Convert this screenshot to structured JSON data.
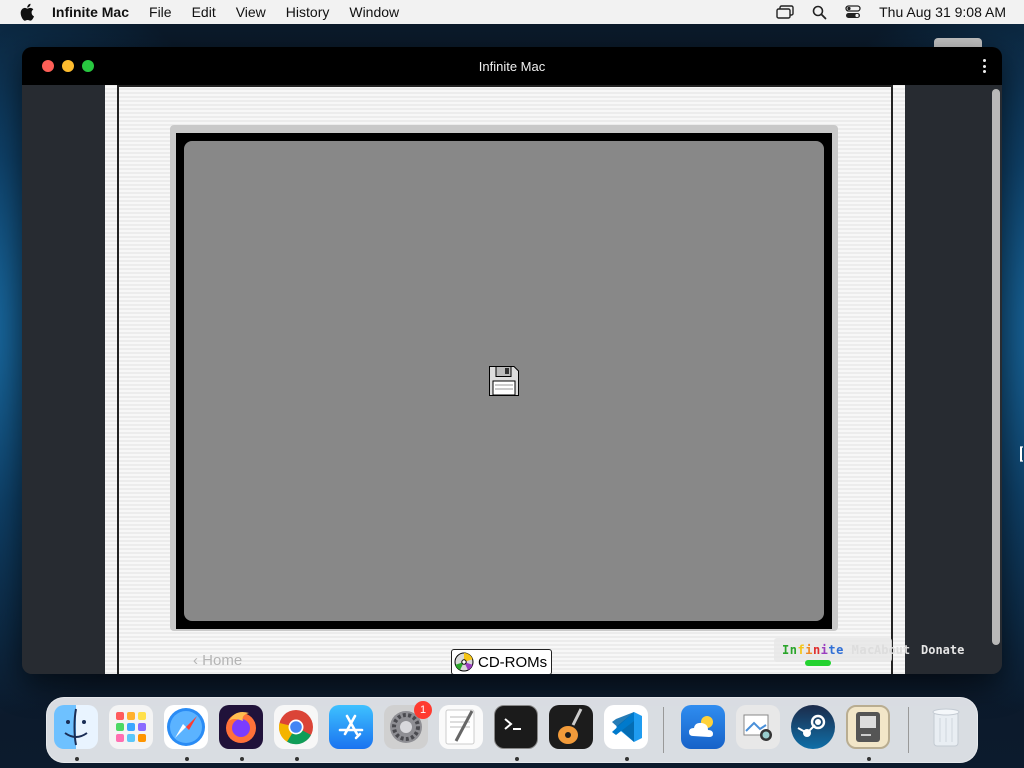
{
  "menubar": {
    "app_name": "Infinite Mac",
    "items": [
      "File",
      "Edit",
      "View",
      "History",
      "Window"
    ],
    "clock": "Thu Aug 31  9:08 AM",
    "status_icons": [
      "screen-mirroring-icon",
      "spotlight-search-icon",
      "control-center-icon"
    ]
  },
  "window": {
    "title": "Infinite Mac",
    "traffic_lights": {
      "close": "#fe5f57",
      "minimize": "#febc2e",
      "zoom": "#28c840"
    }
  },
  "emulator": {
    "screen_color": "#888888",
    "disk_icon": "floppy-disk-icon",
    "home_link": "‹ Home",
    "cdrom_button": "CD-ROMs",
    "footer": {
      "logo_letters": [
        {
          "ch": "I",
          "color": "#2aa52a"
        },
        {
          "ch": "n",
          "color": "#2aa52a"
        },
        {
          "ch": "f",
          "color": "#f5c518"
        },
        {
          "ch": "i",
          "color": "#f08a24"
        },
        {
          "ch": "n",
          "color": "#e03030"
        },
        {
          "ch": "i",
          "color": "#9b3fbf"
        },
        {
          "ch": "t",
          "color": "#2f6fd6"
        },
        {
          "ch": "e",
          "color": "#2f6fd6"
        },
        {
          "ch": " ",
          "color": "#ffffff"
        },
        {
          "ch": "M",
          "color": "#dddddd"
        },
        {
          "ch": "a",
          "color": "#dddddd"
        },
        {
          "ch": "c",
          "color": "#dddddd"
        }
      ],
      "about": "About",
      "donate": "Donate",
      "indicator_color": "#23d230"
    }
  },
  "dock": {
    "apps": [
      {
        "name": "Finder",
        "icon": "finder-icon",
        "running": true
      },
      {
        "name": "Launchpad",
        "icon": "launchpad-icon",
        "running": false
      },
      {
        "name": "Safari",
        "icon": "safari-icon",
        "running": true
      },
      {
        "name": "Firefox",
        "icon": "firefox-icon",
        "running": true
      },
      {
        "name": "Google Chrome",
        "icon": "chrome-icon",
        "running": true
      },
      {
        "name": "App Store",
        "icon": "app-store-icon",
        "running": false
      },
      {
        "name": "System Settings",
        "icon": "system-settings-icon",
        "running": false,
        "badge": "1"
      },
      {
        "name": "TextEdit",
        "icon": "textedit-icon",
        "running": false
      },
      {
        "name": "Terminal",
        "icon": "terminal-icon",
        "running": true
      },
      {
        "name": "GarageBand",
        "icon": "garageband-icon",
        "running": false
      },
      {
        "name": "Visual Studio Code",
        "icon": "vscode-icon",
        "running": true
      },
      {
        "name": "Weather",
        "icon": "weather-icon",
        "running": false
      },
      {
        "name": "Preview",
        "icon": "preview-icon",
        "running": false
      },
      {
        "name": "Steam",
        "icon": "steam-icon",
        "running": false
      },
      {
        "name": "Infinite Mac",
        "icon": "infinite-mac-icon",
        "running": true
      },
      {
        "name": "Trash",
        "icon": "trash-icon",
        "running": false
      }
    ]
  }
}
